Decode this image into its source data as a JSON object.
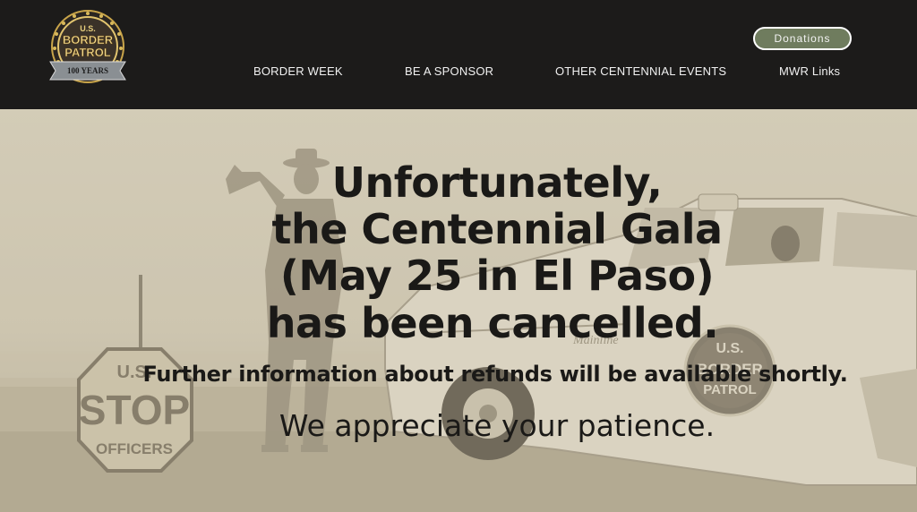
{
  "logo": {
    "line1": "U.S.",
    "line2": "BORDER",
    "line3": "PATROL",
    "line4": "100 YEARS"
  },
  "header": {
    "donate_label": "Donations",
    "nav": [
      {
        "label": "BORDER WEEK"
      },
      {
        "label": "BE A SPONSOR"
      },
      {
        "label": "OTHER CENTENNIAL EVENTS"
      },
      {
        "label": "MWR Links"
      }
    ]
  },
  "hero": {
    "headline_lines": [
      "Unfortunately,",
      "the Centennial Gala",
      "(May 25 in El Paso)",
      "has been cancelled."
    ],
    "subtext": "Further information about refunds will be available shortly.",
    "closing": "We appreciate your patience.",
    "sign": {
      "line1": "U.S.",
      "line2": "STOP",
      "line3": "OFFICERS"
    },
    "door_emblem": {
      "line1": "U.S.",
      "line2": "BORDER",
      "line3": "PATROL"
    },
    "car_script": "Mainline"
  },
  "colors": {
    "header_bg": "#1c1b1a",
    "donate_bg": "#6f7c5e",
    "hero_sepia": "#cbc3ad",
    "text_dark": "#1a1917",
    "logo_gold": "#c9a54a"
  },
  "icons": [
    "border-patrol-logo",
    "stop-sign",
    "patrol-car",
    "officer-figure"
  ]
}
